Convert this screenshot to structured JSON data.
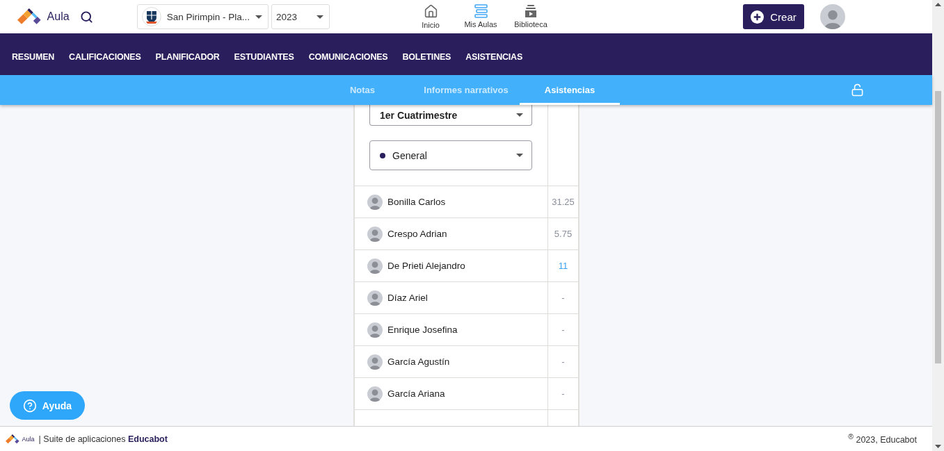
{
  "header": {
    "brand": "Aula",
    "school_select": {
      "value": "San Pirimpin - Pla..."
    },
    "year_select": {
      "value": "2023"
    },
    "nav": [
      {
        "label": "Inicio",
        "kind": "home",
        "selected": false
      },
      {
        "label": "Mis Aulas",
        "kind": "classes",
        "selected": true
      },
      {
        "label": "Biblioteca",
        "kind": "library",
        "selected": false
      }
    ],
    "create_button": "Crear"
  },
  "main_tabs": [
    "RESUMEN",
    "CALIFICACIONES",
    "PLANIFICADOR",
    "ESTUDIANTES",
    "COMUNICACIONES",
    "BOLETINES",
    "ASISTENCIAS"
  ],
  "sub_tabs": [
    {
      "label": "Notas",
      "selected": false
    },
    {
      "label": "Informes narrativos",
      "selected": false
    },
    {
      "label": "Asistencias",
      "selected": true
    }
  ],
  "filters": {
    "period": "1er Cuatrimestre",
    "group": {
      "label": "General",
      "color": "#2a1f5c"
    }
  },
  "students": [
    {
      "name": "Bonilla Carlos",
      "value": "31.25",
      "color": "#8a8f9c"
    },
    {
      "name": "Crespo Adrian",
      "value": "5.75",
      "color": "#8a8f9c"
    },
    {
      "name": "De Prieti Alejandro",
      "value": "11",
      "color": "#3ba3f2"
    },
    {
      "name": "Díaz Ariel",
      "value": "-",
      "color": "#8a8f9c"
    },
    {
      "name": "Enrique Josefina",
      "value": "-",
      "color": "#8a8f9c"
    },
    {
      "name": "García Agustín",
      "value": "-",
      "color": "#8a8f9c"
    },
    {
      "name": "García Ariana",
      "value": "-",
      "color": "#8a8f9c"
    }
  ],
  "help_button": "Ayuda",
  "footer": {
    "brand": "Aula",
    "suite": "| Suite de aplicaciones **Educabot**",
    "copyright": "$^{®}$ 2023, Educabot"
  }
}
